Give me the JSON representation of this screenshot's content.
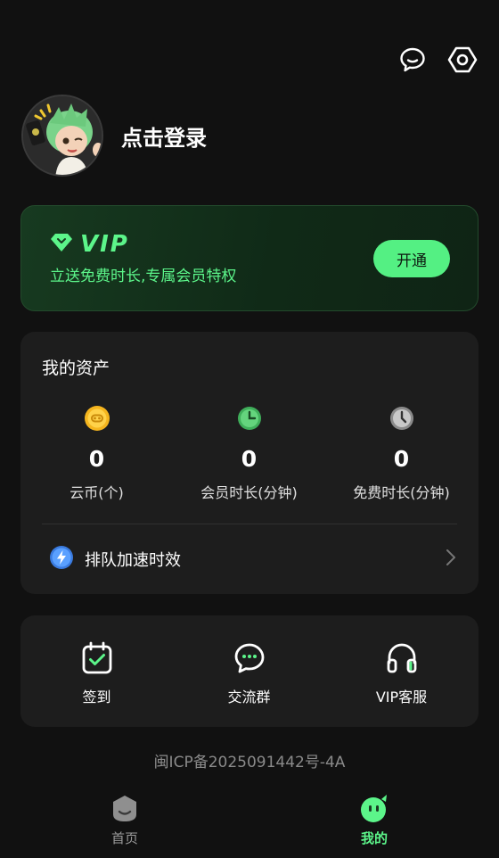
{
  "header": {
    "icons": [
      "chat-bubble-icon",
      "settings-hexagon-icon"
    ]
  },
  "profile": {
    "login_text": "点击登录"
  },
  "vip": {
    "label": "VIP",
    "subtitle": "立送免费时长,专属会员特权",
    "button": "开通",
    "accent": "#5cf58a"
  },
  "assets": {
    "title": "我的资产",
    "items": [
      {
        "value": "0",
        "label": "云币(个)",
        "icon": "coin-icon"
      },
      {
        "value": "0",
        "label": "会员时长(分钟)",
        "icon": "green-clock-icon"
      },
      {
        "value": "0",
        "label": "免费时长(分钟)",
        "icon": "gray-clock-icon"
      }
    ],
    "queue_label": "排队加速时效"
  },
  "actions": [
    {
      "label": "签到",
      "icon": "calendar-check-icon"
    },
    {
      "label": "交流群",
      "icon": "chat-dots-icon"
    },
    {
      "label": "VIP客服",
      "icon": "headset-icon"
    }
  ],
  "footer": {
    "icp": "闽ICP备2025091442号-4A"
  },
  "tabbar": {
    "tabs": [
      {
        "label": "首页",
        "active": false
      },
      {
        "label": "我的",
        "active": true
      }
    ],
    "active_color": "#5cf58a",
    "inactive_color": "#9a9a9a"
  }
}
